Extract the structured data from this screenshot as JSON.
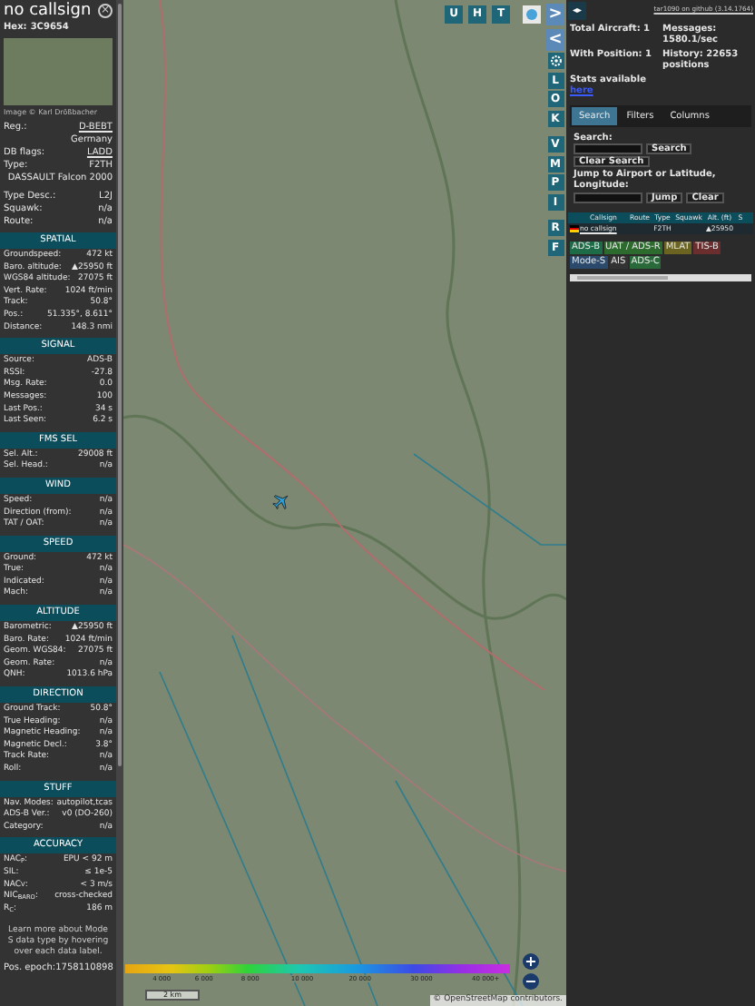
{
  "sidebar": {
    "title": "no callsign",
    "hex_label": "Hex:",
    "hex": "3C9654",
    "close": "×",
    "photo_credit": "Image © Karl Drößbacher",
    "details": [
      {
        "kind": "link",
        "label": "Reg.:",
        "value": "D-BEBT"
      },
      {
        "kind": "value",
        "value": "Germany"
      },
      {
        "kind": "link",
        "label": "DB flags:",
        "value": "LADD"
      },
      {
        "kind": "pair",
        "label": "Type:",
        "value": "F2TH"
      },
      {
        "kind": "value",
        "value": "DASSAULT Falcon 2000"
      },
      {
        "kind": "gap"
      },
      {
        "kind": "pair",
        "label": "Type Desc.:",
        "value": "L2J"
      },
      {
        "kind": "pair",
        "label": "Squawk:",
        "value": "n/a"
      },
      {
        "kind": "pair",
        "label": "Route:",
        "value": "n/a"
      }
    ],
    "sections": [
      {
        "title": "SPATIAL",
        "rows": [
          {
            "label": "Groundspeed:",
            "value": "472 kt"
          },
          {
            "label": "Baro. altitude:",
            "value": "▲25950 ft"
          },
          {
            "label": "WGS84 altitude:",
            "value": "27075 ft"
          },
          {
            "label": "Vert. Rate:",
            "value": "1024 ft/min"
          },
          {
            "label": "Track:",
            "value": "50.8°"
          },
          {
            "label": "Pos.:",
            "value": "51.335°, 8.611°"
          },
          {
            "label": "Distance:",
            "value": "148.3 nmi"
          }
        ]
      },
      {
        "title": "SIGNAL",
        "rows": [
          {
            "label": "Source:",
            "value": "ADS-B"
          },
          {
            "label": "RSSI:",
            "value": "-27.8"
          },
          {
            "label": "Msg. Rate:",
            "value": "0.0"
          },
          {
            "label": "Messages:",
            "value": "100"
          },
          {
            "label": "Last Pos.:",
            "value": "34 s"
          },
          {
            "label": "Last Seen:",
            "value": "6.2 s"
          }
        ]
      },
      {
        "title": "FMS SEL",
        "rows": [
          {
            "label": "Sel. Alt.:",
            "value": "29008 ft"
          },
          {
            "label": "Sel. Head.:",
            "value": "n/a"
          }
        ]
      },
      {
        "title": "WIND",
        "rows": [
          {
            "label": "Speed:",
            "value": "n/a"
          },
          {
            "label": "Direction (from):",
            "value": "n/a"
          },
          {
            "label": "TAT / OAT:",
            "value": "n/a"
          }
        ]
      },
      {
        "title": "SPEED",
        "rows": [
          {
            "label": "Ground:",
            "value": "472 kt"
          },
          {
            "label": "True:",
            "value": "n/a"
          },
          {
            "label": "Indicated:",
            "value": "n/a"
          },
          {
            "label": "Mach:",
            "value": "n/a"
          }
        ]
      },
      {
        "title": "ALTITUDE",
        "rows": [
          {
            "label": "Barometric:",
            "value": "▲25950 ft"
          },
          {
            "label": "Baro. Rate:",
            "value": "1024 ft/min"
          },
          {
            "label": "Geom. WGS84:",
            "value": "27075 ft"
          },
          {
            "label": "Geom. Rate:",
            "value": "n/a"
          },
          {
            "label": "QNH:",
            "value": "1013.6 hPa"
          }
        ]
      },
      {
        "title": "DIRECTION",
        "rows": [
          {
            "label": "Ground Track:",
            "value": "50.8°"
          },
          {
            "label": "True Heading:",
            "value": "n/a"
          },
          {
            "label": "Magnetic Heading:",
            "value": "n/a"
          },
          {
            "label": "Magnetic Decl.:",
            "value": "3.8°"
          },
          {
            "label": "Track Rate:",
            "value": "n/a"
          },
          {
            "label": "Roll:",
            "value": "n/a"
          }
        ]
      },
      {
        "title": "STUFF",
        "rows": [
          {
            "label": "Nav. Modes:",
            "value": "autopilot,tcas"
          },
          {
            "label": "ADS-B Ver.:",
            "value": "v0 (DO-260)"
          },
          {
            "label": "Category:",
            "value": "n/a"
          }
        ]
      },
      {
        "title": "ACCURACY",
        "rows": [
          {
            "label": "NAC$_{P}$:",
            "value": "EPU < 92 m"
          },
          {
            "label": "SIL:",
            "value": "≤ 1e-5"
          },
          {
            "label": "NAC$_{V}$:",
            "value": "< 3 m/s"
          },
          {
            "label": "NIC$_{BARO}$:",
            "value": "cross-checked"
          },
          {
            "label": "R$_{C}$:",
            "value": "186 m"
          }
        ]
      }
    ],
    "footer_note": "Learn more about Mode S data type by hovering over each data label.",
    "pos_epoch": {
      "label": "Pos. epoch:",
      "value": "1758110898"
    }
  },
  "map": {
    "top_buttons": [
      "U",
      "H",
      "T"
    ],
    "side_buttons": [
      {
        "kind": "arrow",
        "label": ">"
      },
      {
        "kind": "arrow",
        "label": "<"
      },
      {
        "kind": "gear"
      },
      {
        "kind": "letter",
        "label": "L"
      },
      {
        "kind": "letter",
        "label": "O"
      },
      {
        "kind": "letter",
        "label": "K"
      },
      {
        "kind": "letter",
        "label": "V"
      },
      {
        "kind": "letter",
        "label": "M"
      },
      {
        "kind": "letter",
        "label": "P"
      },
      {
        "kind": "letter",
        "label": "I"
      },
      {
        "kind": "letter",
        "label": "R"
      },
      {
        "kind": "letter",
        "label": "F"
      }
    ],
    "altitude_legend": [
      "4 000",
      "6 000",
      "8 000",
      "10 000",
      "20 000",
      "30 000",
      "40 000+"
    ],
    "zoom_in": "+",
    "zoom_out": "−",
    "scale": "2 km",
    "attribution": "© OpenStreetMap contributors."
  },
  "panel": {
    "toggle": "◂▸",
    "version_link": "tar1090 on github (3.14.1764)",
    "stats": [
      {
        "label": "Total Aircraft: 1"
      },
      {
        "label": "Messages: 1580.1/sec"
      },
      {
        "label": "With Position: 1"
      },
      {
        "label": "History: 22653 positions"
      }
    ],
    "stats_note": "Stats available",
    "stats_link": "here",
    "tabs": [
      {
        "label": "Search",
        "selected": true
      },
      {
        "label": "Filters",
        "selected": false
      },
      {
        "label": "Columns",
        "selected": false
      }
    ],
    "search_label": "Search:",
    "search_button": "Search",
    "clear_search": "Clear Search",
    "jump_label": "Jump to Airport or Latitude, Longitude:",
    "jump_button": "Jump",
    "clear_button": "Clear",
    "table": {
      "columns": [
        "Callsign",
        "Route",
        "Type",
        "Squawk",
        "Alt. (ft)",
        "S"
      ],
      "rows": [
        {
          "cells": [
            "no callsign",
            "",
            "F2TH",
            "",
            "▲25950",
            ""
          ],
          "selected": false
        }
      ]
    },
    "legend": [
      {
        "label": "ADS-B",
        "color": "#1e6b47"
      },
      {
        "label": "UAT / ADS-R",
        "color": "#2d6a2d"
      },
      {
        "label": "MLAT",
        "color": "#6b6421"
      },
      {
        "label": "TIS-B",
        "color": "#6b2e2e"
      },
      {
        "label": "Mode-S",
        "color": "#2b4a6b"
      },
      {
        "label": "AIS",
        "color": "#333333"
      },
      {
        "label": "ADS-C",
        "color": "#2a6a3a"
      }
    ]
  }
}
